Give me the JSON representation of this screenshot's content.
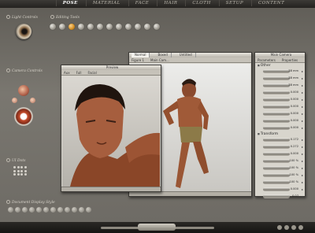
{
  "tabs": [
    "POSE",
    "MATERIAL",
    "FACE",
    "HAIR",
    "CLOTH",
    "SETUP",
    "CONTENT"
  ],
  "active_tab": "POSE",
  "labels": {
    "light_controls": "Light Controls",
    "camera_controls": "Camera Controls",
    "ui_dots": "UI Dots",
    "document_display_style": "Document Display Style"
  },
  "preview": {
    "title": "Preview",
    "toolbar": [
      "Aux",
      "Full",
      "Facial"
    ]
  },
  "main_doc": {
    "tabs": [
      "Normal",
      "Boxed",
      "Untitled"
    ],
    "toolbar": [
      "Figure 1",
      "Main Cam..."
    ]
  },
  "params": {
    "title": "Main Camera",
    "tabs": [
      "Parameters",
      "Properties"
    ],
    "sections": [
      {
        "name": "Other",
        "values": [
          "38 mm",
          "38 mm",
          "38 mm",
          "0.000",
          "0.000",
          "0.000",
          "0.000",
          "0.000",
          "0.000"
        ]
      },
      {
        "name": "Transform",
        "values": [
          "0.172",
          "0.272",
          "0.000",
          "100 %",
          "100 %",
          "100 %",
          "100 %",
          "0.000",
          "0.07"
        ]
      }
    ]
  },
  "colors": {
    "accent": "#d08a20",
    "window_bg": "#d8d5cd",
    "toolbar_bg": "#c6c2b9"
  }
}
